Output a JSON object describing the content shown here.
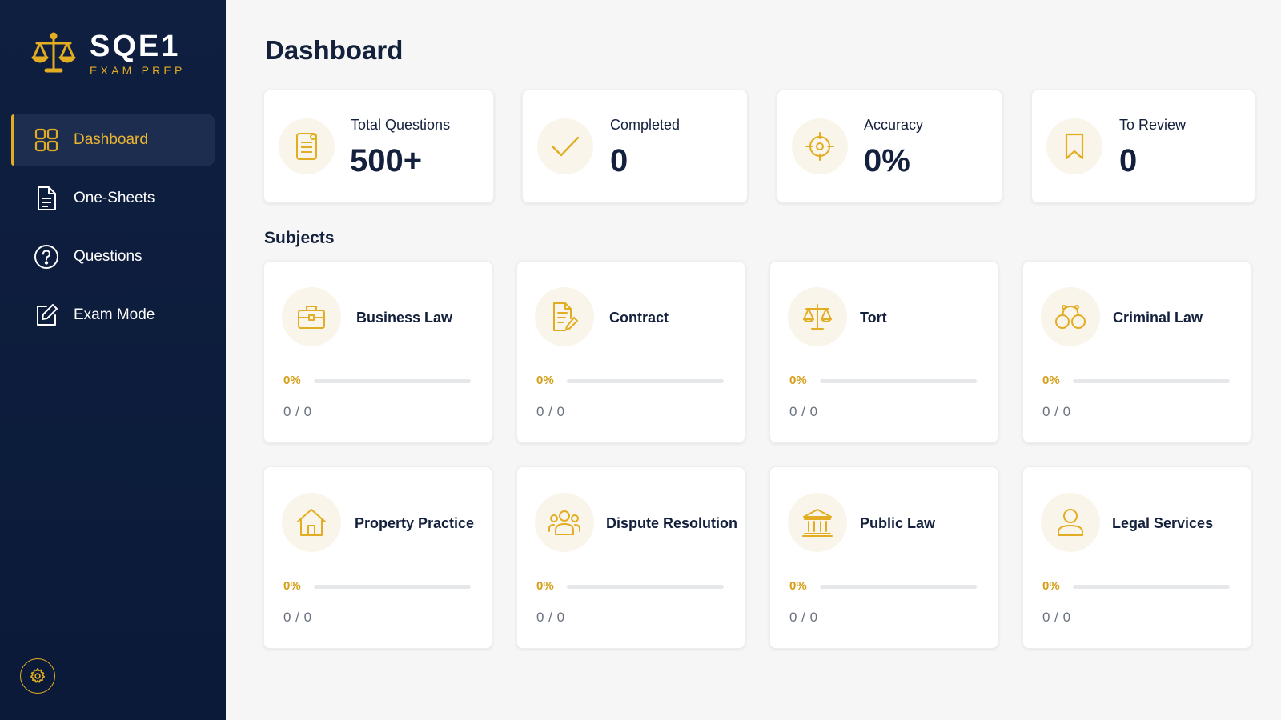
{
  "app": {
    "name": "SQE1",
    "subtitle": "EXAM PREP",
    "colors": {
      "accent": "#e3ad23",
      "sidebar_bg": "#0f1f40",
      "page_bg": "#f6f6f7",
      "text": "#14213d"
    }
  },
  "sidebar": {
    "items": [
      {
        "label": "Dashboard",
        "icon": "grid-icon",
        "active": true
      },
      {
        "label": "One-Sheets",
        "icon": "document-icon",
        "active": false
      },
      {
        "label": "Questions",
        "icon": "question-circle-icon",
        "active": false
      },
      {
        "label": "Exam Mode",
        "icon": "edit-icon",
        "active": false
      }
    ],
    "settings_icon": "gear-icon"
  },
  "main": {
    "title": "Dashboard",
    "stats": [
      {
        "label": "Total Questions",
        "value": "500+",
        "icon": "notes-icon"
      },
      {
        "label": "Completed",
        "value": "0",
        "icon": "check-icon"
      },
      {
        "label": "Accuracy",
        "value": "0%",
        "icon": "target-icon"
      },
      {
        "label": "To Review",
        "value": "0",
        "icon": "bookmark-icon"
      }
    ],
    "subjects_title": "Subjects",
    "subjects": [
      {
        "name": "Business Law",
        "icon": "briefcase-icon",
        "percent": "0%",
        "progress": 0,
        "count": "0 / 0"
      },
      {
        "name": "Contract",
        "icon": "contract-icon",
        "percent": "0%",
        "progress": 0,
        "count": "0 / 0"
      },
      {
        "name": "Tort",
        "icon": "scales-icon",
        "percent": "0%",
        "progress": 0,
        "count": "0 / 0"
      },
      {
        "name": "Criminal Law",
        "icon": "handcuffs-icon",
        "percent": "0%",
        "progress": 0,
        "count": "0 / 0"
      },
      {
        "name": "Property Practice",
        "icon": "house-icon",
        "percent": "0%",
        "progress": 0,
        "count": "0 / 0"
      },
      {
        "name": "Dispute Resolution",
        "icon": "people-icon",
        "percent": "0%",
        "progress": 0,
        "count": "0 / 0"
      },
      {
        "name": "Public Law",
        "icon": "courthouse-icon",
        "percent": "0%",
        "progress": 0,
        "count": "0 / 0"
      },
      {
        "name": "Legal Services",
        "icon": "person-icon",
        "percent": "0%",
        "progress": 0,
        "count": "0 / 0"
      }
    ]
  }
}
